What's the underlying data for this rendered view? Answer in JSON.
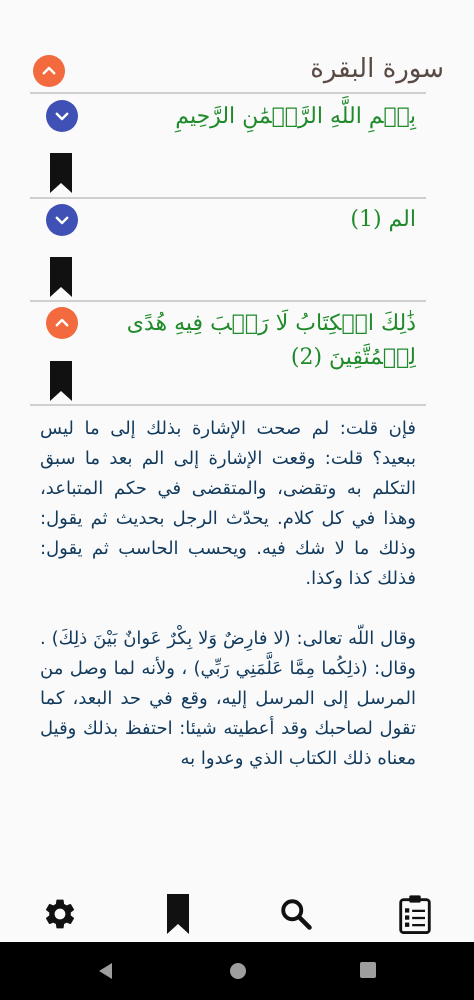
{
  "surah": {
    "title": "سورة البقرة"
  },
  "verses": [
    {
      "text": "بِسۡمِ اللَّهِ الرَّحۡمَٰنِ الرَّحِيمِ"
    },
    {
      "text": "الم (1)"
    },
    {
      "text_line1": "ذَٰلِكَ الۡكِتَابُ لَا رَيۡبَ فِيهِ هُدًى",
      "text_line2": "لِلۡمُتَّقِينَ (2)"
    }
  ],
  "tafsir": {
    "para1": "فإن قلت: لم صحت الإشارة بذلك إلى ما ليس ببعيد؟ قلت: وقعت الإشارة إلى الم بعد ما سبق التكلم به وتقضى، والمتقضى في حكم المتباعد، وهذا في كل كلام. يحدّث الرجل بحديث ثم يقول: وذلك ما لا شك فيه. ويحسب الحاسب ثم يقول: فذلك كذا وكذا.",
    "para2": "وقال اللّه تعالى: (لا فارِضٌ وَلا بِكْرٌ عَوانٌ بَيْنَ ذلِكَ) . وقال: (ذلِكُما مِمَّا عَلَّمَنِي رَبِّي) ، ولأنه لما وصل من المرسل إلى المرسل إليه، وقع في حد البعد، كما تقول لصاحبك وقد أعطيته شيئا: احتفظ بذلك وقيل معناه ذلك الكتاب الذي وعدوا به"
  },
  "colors": {
    "accent_orange": "#f26a3d",
    "accent_blue": "#3f51b5",
    "verse_green": "#1e8a2a",
    "tafsir_blue": "#123a5c"
  },
  "icons": {
    "bottom": [
      "gear-icon",
      "bookmark-icon",
      "search-icon",
      "clipboard-list-icon"
    ],
    "nav": [
      "back-icon",
      "home-icon",
      "recents-icon"
    ]
  }
}
